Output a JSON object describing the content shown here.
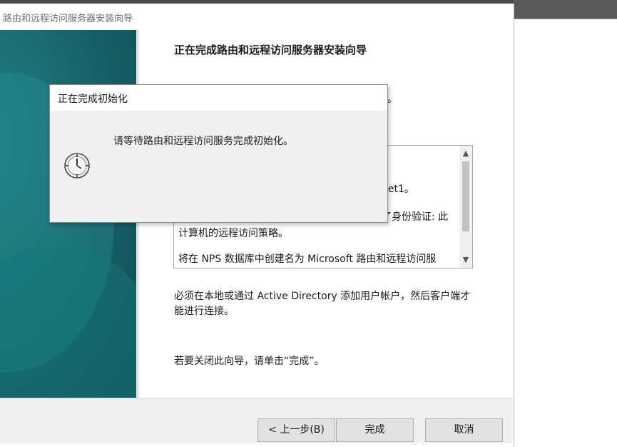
{
  "wizard": {
    "title": "路由和远程访问服务器安装向导",
    "heading": "正在完成路由和远程访问服务器安装向导",
    "intro_tail": "。",
    "summary_lines": [
      "net1。",
      "了身份验证: 此",
      "计算机的远程访问策略。",
      "将在 NPS 数据库中创建名为 Microsoft 路由和远程访问服"
    ],
    "paragraph1": "必须在本地或通过 Active Directory 添加用户帐户，然后客户端才能进行连接。",
    "paragraph2": "若要关闭此向导，请单击“完成”。",
    "buttons": {
      "back": "< 上一步(B)",
      "finish": "完成",
      "cancel": "取消"
    }
  },
  "dialog": {
    "title": "正在完成初始化",
    "message": "请等待路由和远程访问服务完成初始化。",
    "icon": "clock-icon"
  },
  "colors": {
    "side_art": "#1b6d74",
    "footer_bg": "#f0f0f0",
    "button_bg": "#e1e1e1"
  }
}
